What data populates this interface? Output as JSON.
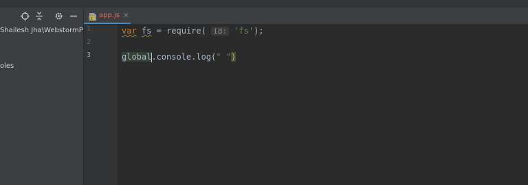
{
  "project": {
    "toolbar_icons": [
      "locate-icon",
      "collapse-icon",
      "gear-icon",
      "minimize-icon"
    ],
    "path_text": "Shailesh Jha\\WebstormProj",
    "ext_text": "oles"
  },
  "editor_tab": {
    "label": "app.js",
    "close": "×",
    "icon": "javascript-file-icon"
  },
  "editor": {
    "line_numbers": [
      "1",
      "2",
      "3"
    ],
    "line1": {
      "kw": "var",
      "sp1": " ",
      "ident": "fs",
      "rest": " = require( ",
      "hint": "id:",
      "sp2": " ",
      "str": "'fs'",
      "end": ");"
    },
    "line3": {
      "global": "global",
      "rest": ".console.log(",
      "str": "\" \"",
      "close": ")"
    }
  }
}
